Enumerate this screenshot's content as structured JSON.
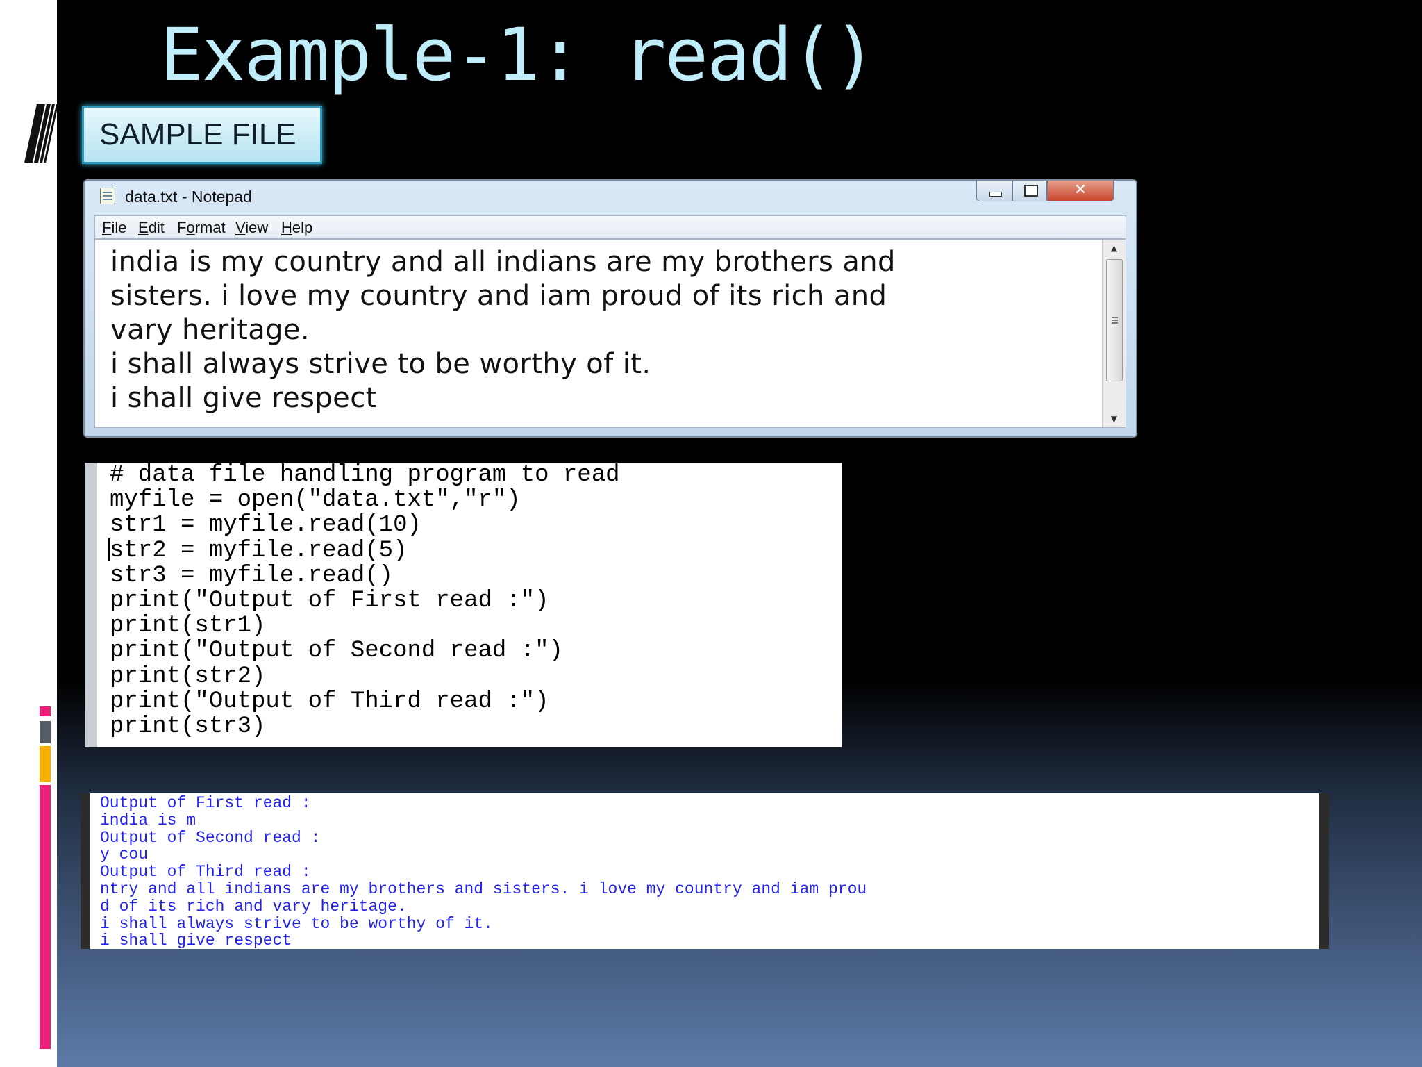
{
  "slide": {
    "title": "Example-1: read()",
    "sample_label": "SAMPLE FILE"
  },
  "notepad": {
    "title": "data.txt - Notepad",
    "close_glyph": "✕",
    "menu": [
      {
        "accel": "F",
        "rest": "ile"
      },
      {
        "accel": "E",
        "rest": "dit"
      },
      {
        "pre": "F",
        "accel": "o",
        "rest": "rmat"
      },
      {
        "accel": "V",
        "rest": "iew"
      },
      {
        "accel": "H",
        "rest": "elp"
      }
    ],
    "lines": [
      "india is my country and all indians are my brothers and",
      "sisters. i love my country and iam proud of its rich and",
      "vary heritage.",
      "i shall always strive to be worthy of it.",
      "i shall give respect"
    ]
  },
  "code": {
    "lines": [
      "# data file handling program to read",
      "myfile = open(\"data.txt\",\"r\")",
      "str1 = myfile.read(10)",
      "str2 = myfile.read(5)",
      "str3 = myfile.read()",
      "print(\"Output of First read :\")",
      "print(str1)",
      "print(\"Output of Second read :\")",
      "print(str2)",
      "print(\"Output of Third read :\")",
      "print(str3)"
    ]
  },
  "output": {
    "color": "#2222ee",
    "lines": [
      "Output of First read :",
      "india is m",
      "Output of Second read :",
      "y cou",
      "Output of Third read :",
      "ntry and all indians are my brothers and sisters. i love my country and iam prou",
      "d of its rich and vary heritage.",
      "i shall always strive to be worthy of it.",
      "i shall give respect"
    ]
  },
  "colors": {
    "title": "#bfeefa",
    "accent_pink": "#e8207a",
    "accent_yellow": "#f5b100",
    "accent_gray": "#555c66"
  }
}
